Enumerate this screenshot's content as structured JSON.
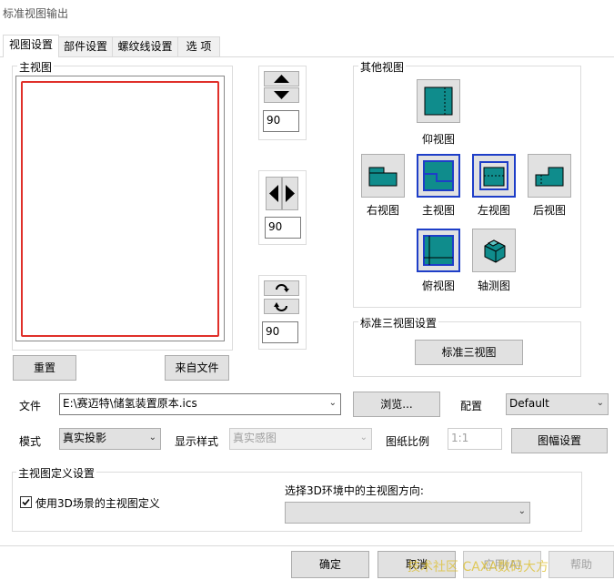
{
  "window": {
    "title": "标准视图输出"
  },
  "tabs": [
    {
      "label": "视图设置",
      "active": true
    },
    {
      "label": "部件设置",
      "active": false
    },
    {
      "label": "螺纹线设置",
      "active": false
    },
    {
      "label": "选  项",
      "active": false
    }
  ],
  "main_view": {
    "group_label": "主视图",
    "reset_label": "重置",
    "from_file_label": "来自文件",
    "rotate_vertical_value": "90",
    "rotate_horizontal_value": "90",
    "rotate_inplane_value": "90"
  },
  "other_views": {
    "group_label": "其他视图",
    "items": [
      {
        "label": "仰视图",
        "icon": "bottom-view-icon"
      },
      {
        "label": "右视图",
        "icon": "right-view-icon"
      },
      {
        "label": "主视图",
        "icon": "front-view-icon"
      },
      {
        "label": "左视图",
        "icon": "left-view-icon"
      },
      {
        "label": "后视图",
        "icon": "back-view-icon"
      },
      {
        "label": "俯视图",
        "icon": "top-view-icon"
      },
      {
        "label": "轴测图",
        "icon": "axonometric-view-icon"
      }
    ]
  },
  "standard_three": {
    "group_label": "标准三视图设置",
    "button_label": "标准三视图"
  },
  "file": {
    "label": "文件",
    "value": "E:\\赛迈特\\储氢装置原本.ics",
    "browse_label": "浏览...",
    "config_label": "配置",
    "config_value": "Default"
  },
  "mode": {
    "label": "模式",
    "value": "真实投影",
    "display_style_label": "显示样式",
    "display_style_value": "真实感图",
    "scale_label": "图纸比例",
    "scale_value": "1:1",
    "frame_settings_label": "图幅设置"
  },
  "main_view_def": {
    "group_label": "主视图定义设置",
    "checkbox_label": "使用3D场景的主视图定义",
    "checkbox_checked": true,
    "direction_label": "选择3D环境中的主视图方向:",
    "direction_value": ""
  },
  "footer": {
    "ok_label": "确定",
    "cancel_label": "取消",
    "apply_label": "应用(A)",
    "help_label": "帮助"
  },
  "watermark": {
    "text": "技术社区  CAXA数码大方"
  },
  "colors": {
    "teal": "#0f8c8c",
    "preview_border": "#e0302a",
    "accent_blue": "#1e3ec8"
  }
}
